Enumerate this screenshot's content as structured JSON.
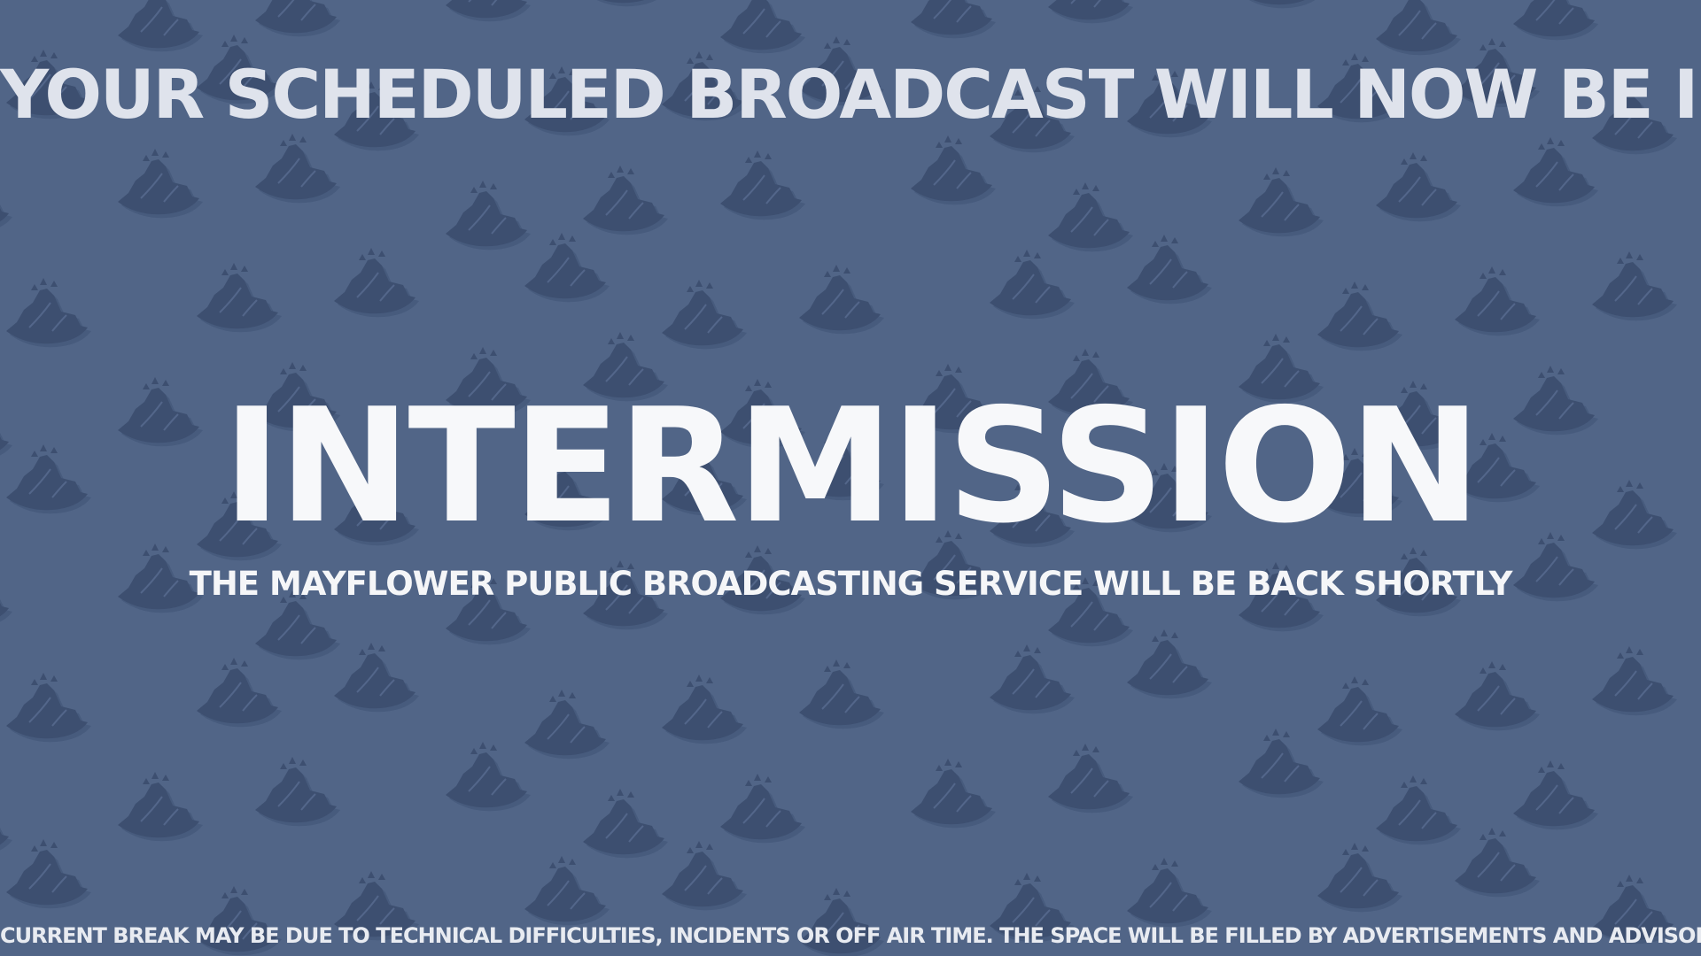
{
  "screen": {
    "heading": "YOUR SCHEDULED BROADCAST WILL NOW BE IN",
    "title": "INTERMISSION",
    "subtitle": "THE MAYFLOWER PUBLIC BROADCASTING SERVICE WILL BE BACK SHORTLY",
    "footer": "CURRENT BREAK MAY BE DUE TO TECHNICAL DIFFICULTIES, INCIDENTS OR OFF AIR TIME. THE SPACE WILL BE FILLED BY ADVERTISEMENTS AND ADVISORIES."
  },
  "background": {
    "color": "#516587",
    "pattern_icon": "mayflower-ship-icon",
    "pattern_color": "#3d4f70"
  }
}
